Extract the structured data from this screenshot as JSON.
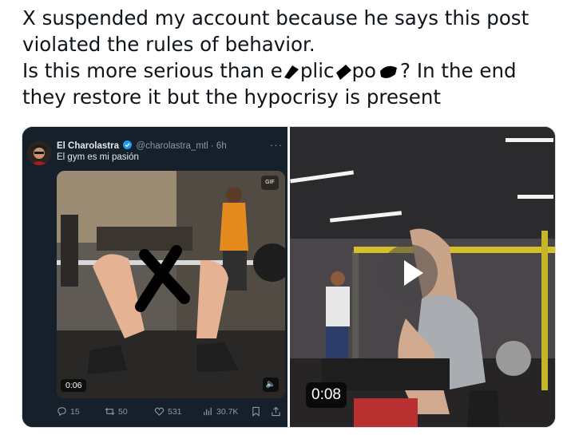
{
  "post": {
    "line1": "X suspended my account because he says this post",
    "line2": "violated the rules of behavior.",
    "line3_start": "Is this more serious than e",
    "line3_frag1": "plic",
    "line3_frag2": "po",
    "line3_end": "? In the end",
    "line4": "they restore it but the hypocrisy is present"
  },
  "embedded_tweet": {
    "author_name": "El Charolastra",
    "handle": "@charolastra_mtl",
    "separator": " · ",
    "time_ago": "6h",
    "more_label": "···",
    "caption": "El gym es mi pasión",
    "video_time": "0:06",
    "gif_badge": "GIF",
    "stats": {
      "replies": "15",
      "reposts": "50",
      "likes": "531",
      "views": "30.7K"
    },
    "icons": [
      "verified-icon",
      "reply-icon",
      "repost-icon",
      "like-icon",
      "views-icon",
      "bookmark-icon",
      "share-icon",
      "volume-icon"
    ]
  },
  "right_video": {
    "time": "0:08"
  },
  "colors": {
    "tweet_bg": "#15202b",
    "verified": "#1d9bf0",
    "muted": "#8b98a5",
    "text": "#0f1419"
  }
}
